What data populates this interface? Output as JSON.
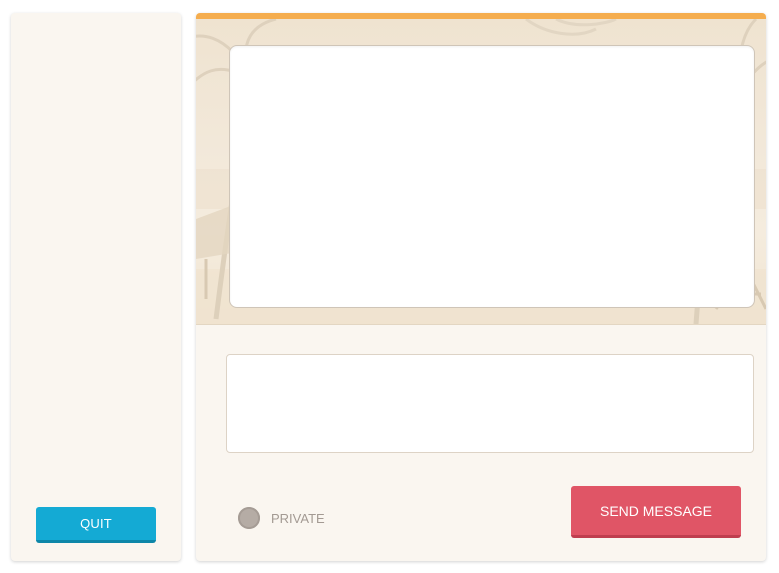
{
  "sidebar": {
    "quit_label": "QUIT"
  },
  "chat": {
    "message_log": "",
    "input": {
      "value": "",
      "placeholder": ""
    },
    "private_label": "PRIVATE",
    "send_label": "SEND MESSAGE"
  },
  "colors": {
    "accent_bar": "#f5ad4e",
    "quit_button": "#14aad4",
    "send_button": "#e05566",
    "panel_background": "#faf6f0",
    "private_radio": "#b5aca5"
  }
}
